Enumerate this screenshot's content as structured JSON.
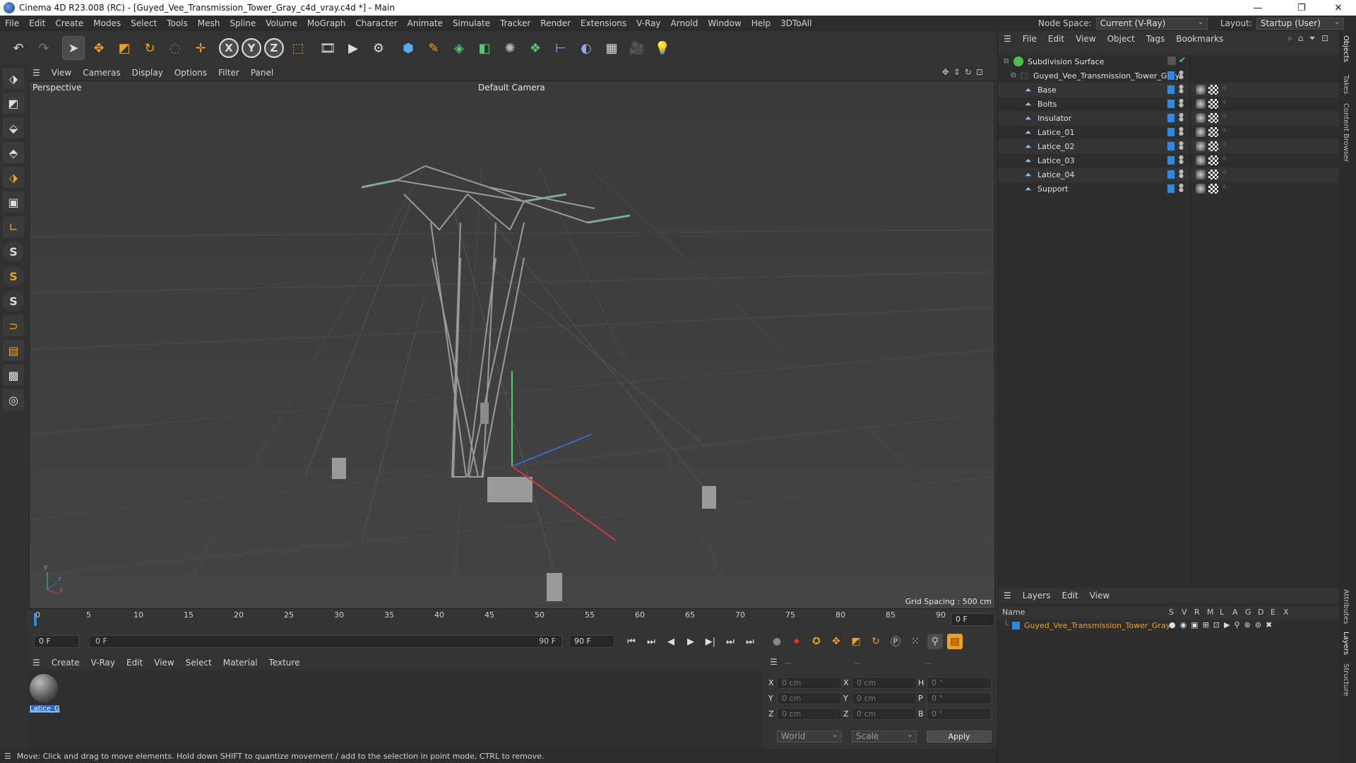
{
  "window": {
    "title": "Cinema 4D R23.008 (RC) - [Guyed_Vee_Transmission_Tower_Gray_c4d_vray.c4d *] - Main",
    "min": "—",
    "max": "❐",
    "close": "✕"
  },
  "menu": [
    "File",
    "Edit",
    "Create",
    "Modes",
    "Select",
    "Tools",
    "Mesh",
    "Spline",
    "Volume",
    "MoGraph",
    "Character",
    "Animate",
    "Simulate",
    "Tracker",
    "Render",
    "Extensions",
    "V-Ray",
    "Arnold",
    "Window",
    "Help",
    "3DToAll"
  ],
  "node_space": {
    "label": "Node Space:",
    "value": "Current (V-Ray)"
  },
  "layout": {
    "label": "Layout:",
    "value": "Startup (User)"
  },
  "toolbar": {
    "icons": [
      "undo-icon",
      "redo-icon",
      "select-arrow-icon",
      "move-icon",
      "scale-icon",
      "rotate-icon",
      "live-select-icon",
      "transform-icon",
      "x-axis-icon",
      "y-axis-icon",
      "z-axis-icon",
      "coordinate-system-icon",
      "render-view-icon",
      "render-picture-viewer-icon",
      "render-settings-icon",
      "cube-icon",
      "pen-icon",
      "subdivision-icon",
      "extrude-icon",
      "cloner-icon",
      "array-icon",
      "symmetry-icon",
      "deformer-icon",
      "floor-icon",
      "camera-icon",
      "light-icon"
    ],
    "axis_x": "X",
    "axis_y": "Y",
    "axis_z": "Z"
  },
  "viewport": {
    "menu": [
      "View",
      "Cameras",
      "Display",
      "Options",
      "Filter",
      "Panel"
    ],
    "view_name": "Perspective",
    "camera": "Default Camera",
    "grid_spacing": "Grid Spacing : 500 cm",
    "axis_y": "y",
    "axis_z": "z",
    "axis_x": "x"
  },
  "left_tools": [
    "model-mode-icon",
    "texture-mode-icon",
    "points-mode-icon",
    "edges-mode-icon",
    "polygons-mode-icon",
    "uv-mode-icon",
    "workplane-icon",
    "snap-icon",
    "snap-settings-icon",
    "snap-quantize-icon",
    "magnet-icon",
    "grid-icon",
    "layers-grid-icon",
    "soft-selection-icon"
  ],
  "timeline": {
    "ticks": [
      "0",
      "5",
      "10",
      "15",
      "20",
      "25",
      "30",
      "35",
      "40",
      "45",
      "50",
      "55",
      "60",
      "65",
      "70",
      "75",
      "80",
      "85",
      "90"
    ],
    "current_frame": "0 F"
  },
  "transport": {
    "start": "0 F",
    "slider_start": "0 F",
    "slider_end": "90 F",
    "end": "90 F"
  },
  "material_menu": [
    "Create",
    "V-Ray",
    "Edit",
    "View",
    "Select",
    "Material",
    "Texture"
  ],
  "materials": [
    {
      "name": "Latice_G"
    }
  ],
  "coords": {
    "header": [
      "--",
      "--",
      "--"
    ],
    "rows": [
      {
        "a": "X",
        "av": "0 cm",
        "b": "X",
        "bv": "0 cm",
        "c": "H",
        "cv": "0 °"
      },
      {
        "a": "Y",
        "av": "0 cm",
        "b": "Y",
        "bv": "0 cm",
        "c": "P",
        "cv": "0 °"
      },
      {
        "a": "Z",
        "av": "0 cm",
        "b": "Z",
        "bv": "0 cm",
        "c": "B",
        "cv": "0 °"
      }
    ],
    "space": "World",
    "mode": "Scale",
    "apply": "Apply"
  },
  "status": "Move: Click and drag to move elements. Hold down SHIFT to quantize movement / add to the selection in point mode, CTRL to remove.",
  "object_manager": {
    "menu": [
      "File",
      "Edit",
      "View",
      "Object",
      "Tags",
      "Bookmarks"
    ],
    "objects": [
      {
        "name": "Subdivision Surface",
        "level": 0
      },
      {
        "name": "Guyed_Vee_Transmission_Tower_Gray",
        "level": 1
      },
      {
        "name": "Base",
        "level": 2
      },
      {
        "name": "Bolts",
        "level": 2
      },
      {
        "name": "Insulator",
        "level": 2
      },
      {
        "name": "Latice_01",
        "level": 2
      },
      {
        "name": "Latice_02",
        "level": 2
      },
      {
        "name": "Latice_03",
        "level": 2
      },
      {
        "name": "Latice_04",
        "level": 2
      },
      {
        "name": "Support",
        "level": 2
      }
    ]
  },
  "layer_manager": {
    "menu": [
      "Layers",
      "Edit",
      "View"
    ],
    "name_header": "Name",
    "columns": [
      "S",
      "V",
      "R",
      "M",
      "L",
      "A",
      "G",
      "D",
      "E",
      "X"
    ],
    "layers": [
      {
        "name": "Guyed_Vee_Transmission_Tower_Gray",
        "color": "#f0a020"
      }
    ]
  },
  "side_tabs": [
    "Objects",
    "Takes",
    "Content Browser",
    "Attributes",
    "Layers",
    "Structure"
  ],
  "colors": {
    "accent_blue": "#2a8ae6",
    "layer_orange": "#f0a020",
    "object_green": "#4dbf4d"
  }
}
